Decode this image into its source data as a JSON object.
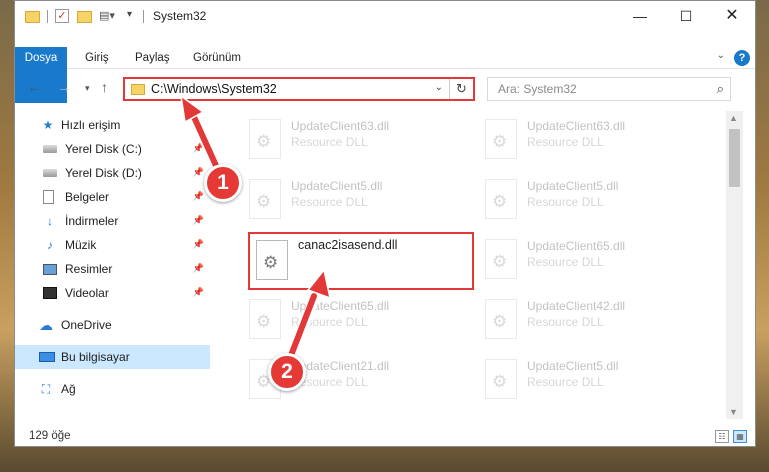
{
  "window": {
    "title": "System32",
    "minimize_glyph": "—",
    "maximize_glyph": "☐",
    "close_glyph": "✕"
  },
  "quick_access": {
    "check_glyph": "✓",
    "props_glyph": "▤▾",
    "dropdown_glyph": "▾"
  },
  "ribbon": {
    "tabs": [
      "Dosya",
      "Giriş",
      "Paylaş",
      "Görünüm"
    ],
    "expand_glyph": "⌄",
    "help_glyph": "?"
  },
  "nav": {
    "back_glyph": "←",
    "forward_glyph": "→",
    "recent_glyph": "▾",
    "up_glyph": "↑",
    "address": "C:\\Windows\\System32",
    "address_dropdown_glyph": "⌄",
    "refresh_glyph": "↻",
    "search_placeholder": "Ara: System32",
    "search_icon_glyph": "⌕"
  },
  "sidebar": {
    "items": [
      {
        "label": "Hızlı erişim",
        "icon": "star-icon",
        "glyph": "★",
        "pinned": false
      },
      {
        "label": "Yerel Disk (C:)",
        "icon": "drive-icon",
        "glyph": "",
        "pinned": true
      },
      {
        "label": "Yerel Disk (D:)",
        "icon": "drive-icon",
        "glyph": "",
        "pinned": true
      },
      {
        "label": "Belgeler",
        "icon": "documents-icon",
        "glyph": "",
        "pinned": true
      },
      {
        "label": "İndirmeler",
        "icon": "download-icon",
        "glyph": "↓",
        "pinned": true
      },
      {
        "label": "Müzik",
        "icon": "music-icon",
        "glyph": "♪",
        "pinned": true
      },
      {
        "label": "Resimler",
        "icon": "pictures-icon",
        "glyph": "",
        "pinned": true
      },
      {
        "label": "Videolar",
        "icon": "videos-icon",
        "glyph": "",
        "pinned": true
      },
      {
        "label": "OneDrive",
        "icon": "cloud-icon",
        "glyph": "☁",
        "pinned": false
      },
      {
        "label": "Bu bilgisayar",
        "icon": "computer-icon",
        "glyph": "",
        "pinned": false,
        "selected": true
      },
      {
        "label": "Ağ",
        "icon": "network-icon",
        "glyph": "⛶",
        "pinned": false
      }
    ],
    "pin_glyph": "📌"
  },
  "files": [
    {
      "name": "UpdateClient63.dll",
      "type": "Resource DLL"
    },
    {
      "name": "UpdateClient63.dll",
      "type": "Resource DLL"
    },
    {
      "name": "UpdateClient5.dll",
      "type": "Resource DLL"
    },
    {
      "name": "UpdateClient5.dll",
      "type": "Resource DLL"
    },
    {
      "name": "canac2isasend.dll",
      "type": ""
    },
    {
      "name": "UpdateClient65.dll",
      "type": "Resource DLL"
    },
    {
      "name": "UpdateClient65.dll",
      "type": "Resource DLL"
    },
    {
      "name": "UpdateClient42.dll",
      "type": "Resource DLL"
    },
    {
      "name": "UpdateClient21.dll",
      "type": "Resource DLL"
    },
    {
      "name": "UpdateClient5.dll",
      "type": "Resource DLL"
    }
  ],
  "scrollbar": {
    "up_glyph": "▲",
    "down_glyph": "▼"
  },
  "status": {
    "item_count": "129 öğe",
    "details_glyph": "☷",
    "tiles_glyph": "▦"
  },
  "annotations": {
    "step1": "1",
    "step2": "2",
    "accent": "#e33838"
  }
}
